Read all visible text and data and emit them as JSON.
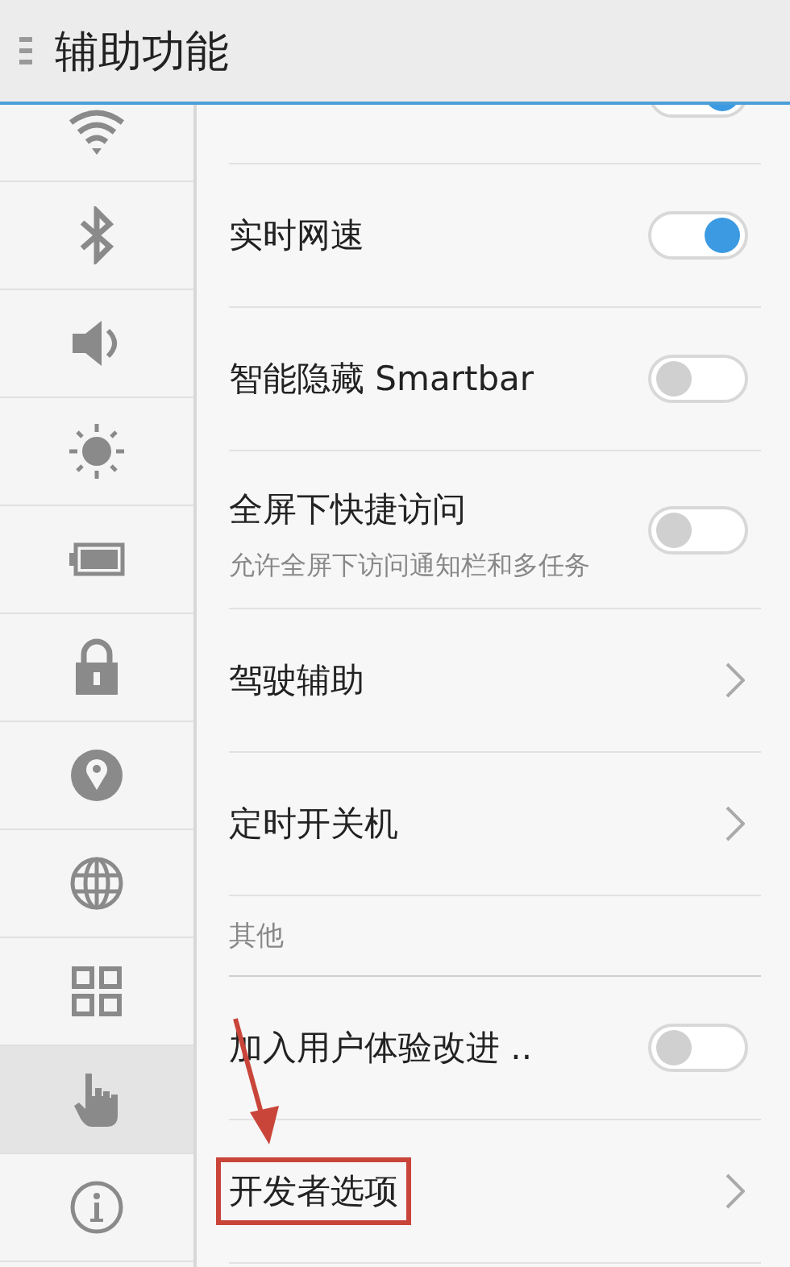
{
  "header": {
    "title": "辅助功能"
  },
  "sidebar": {
    "items": [
      {
        "selected": false
      },
      {
        "selected": false
      },
      {
        "selected": false
      },
      {
        "selected": false
      },
      {
        "selected": false
      },
      {
        "selected": false
      },
      {
        "selected": false
      },
      {
        "selected": false
      },
      {
        "selected": false
      },
      {
        "selected": true
      },
      {
        "selected": false
      }
    ]
  },
  "settings": [
    {
      "kind": "partial",
      "on": true
    },
    {
      "kind": "toggle",
      "label": "实时网速",
      "on": true,
      "highlighted": false
    },
    {
      "kind": "toggle",
      "label": "智能隐藏 Smartbar",
      "on": false,
      "highlighted": false
    },
    {
      "kind": "toggle",
      "label": "全屏下快捷访问",
      "description": "允许全屏下访问通知栏和多任务",
      "on": false,
      "highlighted": false
    },
    {
      "kind": "link",
      "label": "驾驶辅助",
      "highlighted": false
    },
    {
      "kind": "link",
      "label": "定时开关机",
      "highlighted": false
    },
    {
      "kind": "section",
      "label": "其他"
    },
    {
      "kind": "toggle",
      "label": "加入用户体验改进 ..",
      "on": false,
      "highlighted": false
    },
    {
      "kind": "link",
      "label": "开发者选项",
      "highlighted": true
    }
  ]
}
